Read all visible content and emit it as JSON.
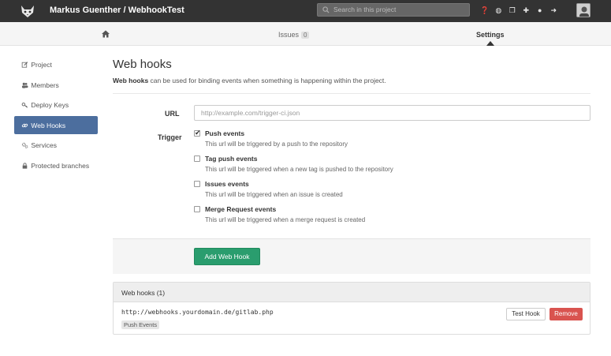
{
  "header": {
    "title": "Markus Guenther / WebhookTest",
    "search_placeholder": "Search in this project",
    "icons": [
      "help-icon",
      "globe-icon",
      "copy-icon",
      "plus-icon",
      "user-icon",
      "logout-icon"
    ]
  },
  "subnav": {
    "issues_label": "Issues",
    "issues_count": "0",
    "settings_label": "Settings"
  },
  "sidebar": {
    "items": [
      {
        "label": "Project",
        "icon": "edit-icon"
      },
      {
        "label": "Members",
        "icon": "users-icon"
      },
      {
        "label": "Deploy Keys",
        "icon": "key-icon"
      },
      {
        "label": "Web Hooks",
        "icon": "link-icon",
        "active": true
      },
      {
        "label": "Services",
        "icon": "cogs-icon"
      },
      {
        "label": "Protected branches",
        "icon": "lock-icon"
      }
    ]
  },
  "main": {
    "title": "Web hooks",
    "desc_strong": "Web hooks",
    "desc_rest": " can be used for binding events when something is happening within the project.",
    "url_label": "URL",
    "url_placeholder": "http://example.com/trigger-ci.json",
    "trigger_label": "Trigger",
    "triggers": [
      {
        "name": "Push events",
        "desc": "This url will be triggered by a push to the repository",
        "checked": true
      },
      {
        "name": "Tag push events",
        "desc": "This url will be triggered when a new tag is pushed to the repository",
        "checked": false
      },
      {
        "name": "Issues events",
        "desc": "This url will be triggered when an issue is created",
        "checked": false
      },
      {
        "name": "Merge Request events",
        "desc": "This url will be triggered when a merge request is created",
        "checked": false
      }
    ],
    "add_button": "Add Web Hook"
  },
  "hooks": {
    "heading": "Web hooks (1)",
    "items": [
      {
        "url": "http://webhooks.yourdomain.de/gitlab.php",
        "tag": "Push Events",
        "test_label": "Test Hook",
        "remove_label": "Remove"
      }
    ]
  },
  "colors": {
    "topbar": "#333333",
    "sidebar_active": "#4c6e9e",
    "add_button": "#2a9d6e",
    "remove_button": "#d9534f"
  }
}
